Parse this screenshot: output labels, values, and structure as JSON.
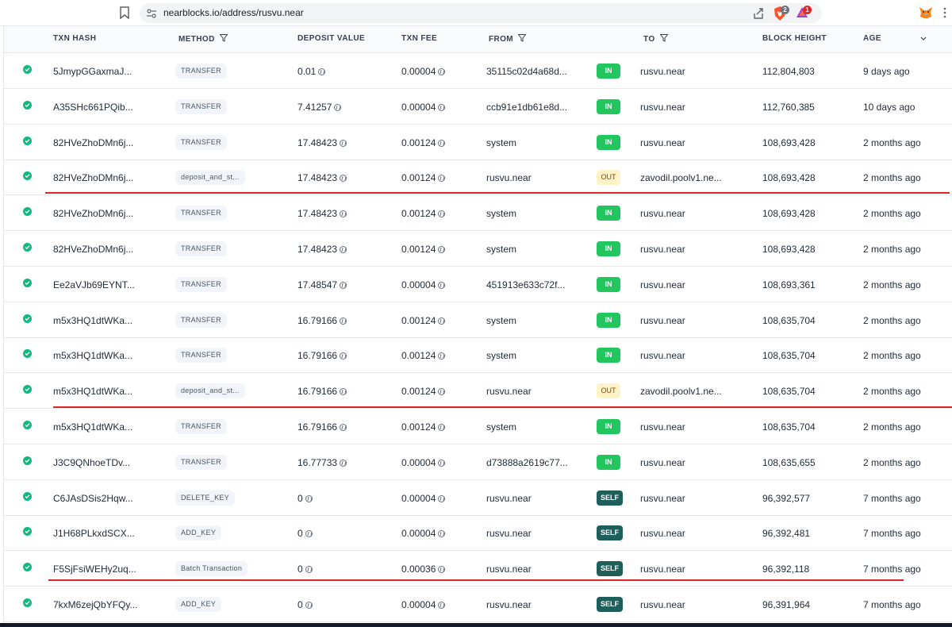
{
  "browser": {
    "url": "nearblocks.io/address/rusvu.near",
    "brave_badge": "2",
    "rewards_badge": "1"
  },
  "colors": {
    "accent_green": "#22c55e",
    "out_bg": "#fef3c7",
    "self_bg": "#1f5f5b",
    "annotation_red": "#dc2626"
  },
  "table": {
    "headers": {
      "txn_hash": "TXN HASH",
      "method": "METHOD",
      "deposit_value": "DEPOSIT VALUE",
      "txn_fee": "TXN FEE",
      "from": "FROM",
      "to": "TO",
      "block_height": "BLOCK HEIGHT",
      "age": "AGE"
    },
    "rows": [
      {
        "hash": "5JmypGGaxmaJ...",
        "method": "TRANSFER",
        "deposit": "0.01",
        "fee": "0.00004",
        "from": "35115c02d4a68d...",
        "dir": "IN",
        "to": "rusvu.near",
        "block": "112,804,803",
        "age": "9 days ago"
      },
      {
        "hash": "A35SHc661PQib...",
        "method": "TRANSFER",
        "deposit": "7.41257",
        "fee": "0.00004",
        "from": "ccb91e1db61e8d...",
        "dir": "IN",
        "to": "rusvu.near",
        "block": "112,760,385",
        "age": "10 days ago"
      },
      {
        "hash": "82HVeZhoDMn6j...",
        "method": "TRANSFER",
        "deposit": "17.48423",
        "fee": "0.00124",
        "from": "system",
        "dir": "IN",
        "to": "rusvu.near",
        "block": "108,693,428",
        "age": "2 months ago"
      },
      {
        "hash": "82HVeZhoDMn6j...",
        "method": "deposit_and_st...",
        "deposit": "17.48423",
        "fee": "0.00124",
        "from": "rusvu.near",
        "dir": "OUT",
        "to": "zavodil.poolv1.ne...",
        "block": "108,693,428",
        "age": "2 months ago"
      },
      {
        "hash": "82HVeZhoDMn6j...",
        "method": "TRANSFER",
        "deposit": "17.48423",
        "fee": "0.00124",
        "from": "system",
        "dir": "IN",
        "to": "rusvu.near",
        "block": "108,693,428",
        "age": "2 months ago"
      },
      {
        "hash": "82HVeZhoDMn6j...",
        "method": "TRANSFER",
        "deposit": "17.48423",
        "fee": "0.00124",
        "from": "system",
        "dir": "IN",
        "to": "rusvu.near",
        "block": "108,693,428",
        "age": "2 months ago"
      },
      {
        "hash": "Ee2aVJb69EYNT...",
        "method": "TRANSFER",
        "deposit": "17.48547",
        "fee": "0.00004",
        "from": "451913e633c72f...",
        "dir": "IN",
        "to": "rusvu.near",
        "block": "108,693,361",
        "age": "2 months ago"
      },
      {
        "hash": "m5x3HQ1dtWKa...",
        "method": "TRANSFER",
        "deposit": "16.79166",
        "fee": "0.00124",
        "from": "system",
        "dir": "IN",
        "to": "rusvu.near",
        "block": "108,635,704",
        "age": "2 months ago"
      },
      {
        "hash": "m5x3HQ1dtWKa...",
        "method": "TRANSFER",
        "deposit": "16.79166",
        "fee": "0.00124",
        "from": "system",
        "dir": "IN",
        "to": "rusvu.near",
        "block": "108,635,704",
        "age": "2 months ago"
      },
      {
        "hash": "m5x3HQ1dtWKa...",
        "method": "deposit_and_st...",
        "deposit": "16.79166",
        "fee": "0.00124",
        "from": "rusvu.near",
        "dir": "OUT",
        "to": "zavodil.poolv1.ne...",
        "block": "108,635,704",
        "age": "2 months ago"
      },
      {
        "hash": "m5x3HQ1dtWKa...",
        "method": "TRANSFER",
        "deposit": "16.79166",
        "fee": "0.00124",
        "from": "system",
        "dir": "IN",
        "to": "rusvu.near",
        "block": "108,635,704",
        "age": "2 months ago"
      },
      {
        "hash": "J3C9QNhoeTDv...",
        "method": "TRANSFER",
        "deposit": "16.77733",
        "fee": "0.00004",
        "from": "d73888a2619c77...",
        "dir": "IN",
        "to": "rusvu.near",
        "block": "108,635,655",
        "age": "2 months ago"
      },
      {
        "hash": "C6JAsDSis2Hqw...",
        "method": "DELETE_KEY",
        "deposit": "0",
        "fee": "0.00004",
        "from": "rusvu.near",
        "dir": "SELF",
        "to": "rusvu.near",
        "block": "96,392,577",
        "age": "7 months ago"
      },
      {
        "hash": "J1H68PLkxdSCX...",
        "method": "ADD_KEY",
        "deposit": "0",
        "fee": "0.00004",
        "from": "rusvu.near",
        "dir": "SELF",
        "to": "rusvu.near",
        "block": "96,392,481",
        "age": "7 months ago"
      },
      {
        "hash": "F5SjFsiWEHy2uq...",
        "method": "Batch Transaction",
        "deposit": "0",
        "fee": "0.00036",
        "from": "rusvu.near",
        "dir": "SELF",
        "to": "rusvu.near",
        "block": "96,392,118",
        "age": "7 months ago"
      },
      {
        "hash": "7kxM6zejQbYFQy...",
        "method": "ADD_KEY",
        "deposit": "0",
        "fee": "0.00004",
        "from": "rusvu.near",
        "dir": "SELF",
        "to": "rusvu.near",
        "block": "96,391,964",
        "age": "7 months ago"
      }
    ]
  }
}
